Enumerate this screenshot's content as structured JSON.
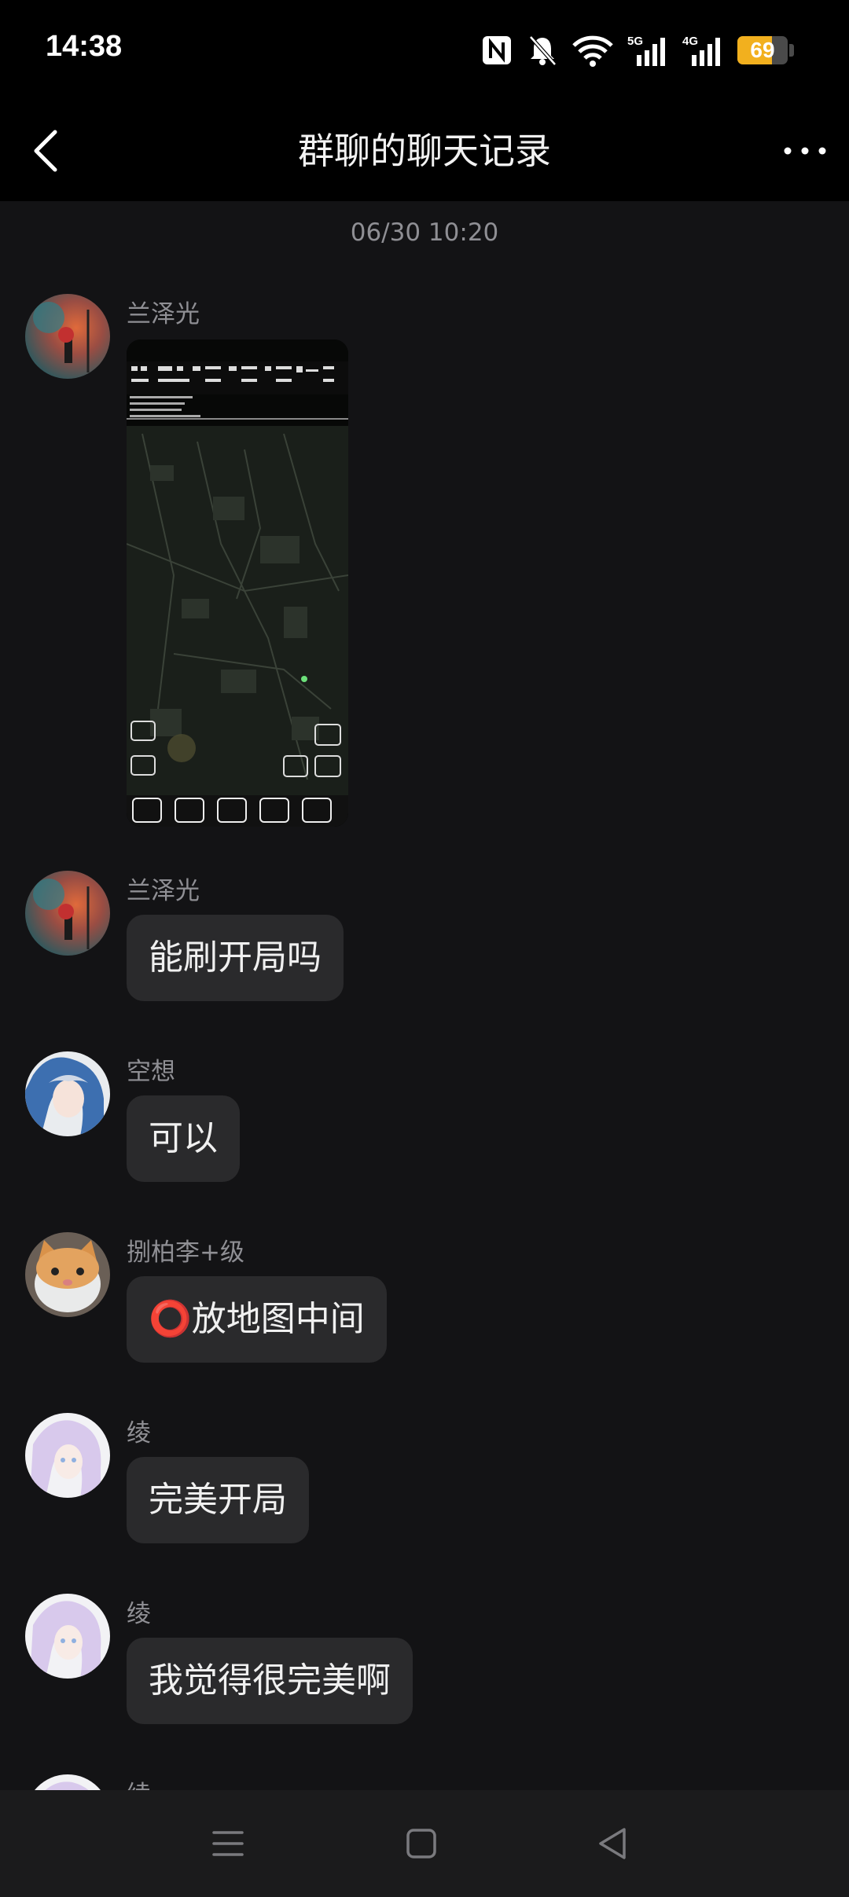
{
  "status_bar": {
    "time": "14:38",
    "battery_level": "69",
    "network_1": "5G",
    "network_2": "4G"
  },
  "header": {
    "title": "群聊的聊天记录"
  },
  "chat": {
    "timestamp": "06/30 10:20",
    "messages": [
      {
        "sender": "兰泽光",
        "type": "image"
      },
      {
        "sender": "兰泽光",
        "text": "能刷开局吗"
      },
      {
        "sender": "空想",
        "text": "可以"
      },
      {
        "sender": "捌柏李+级",
        "text": "⭕放地图中间"
      },
      {
        "sender": "绫",
        "text": "完美开局"
      },
      {
        "sender": "绫",
        "text": "我觉得很完美啊"
      },
      {
        "sender": "绫",
        "text": ""
      }
    ]
  },
  "colors": {
    "background": "#131315",
    "header": "#000000",
    "bubble": "#2a2a2c",
    "battery": "#f2b01e"
  }
}
